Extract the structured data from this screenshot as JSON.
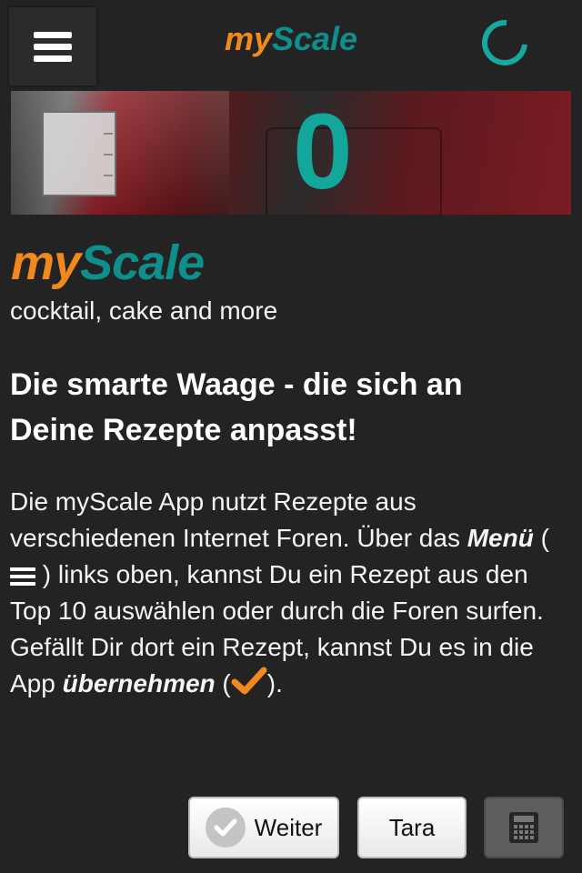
{
  "header": {
    "title_part1": "my",
    "title_part2": "Scale",
    "menu_icon": "hamburger-menu-icon",
    "status_icon": "loading-spinner-icon"
  },
  "scale": {
    "weight": "0"
  },
  "main": {
    "brand_part1": "my",
    "brand_part2": "Scale",
    "tagline": "cocktail, cake and more",
    "headline_line1": "Die smarte Waage - die sich an",
    "headline_line2": "Deine Rezepte anpasst!",
    "body_1": "Die myScale App nutzt Rezepte aus verschiedenen Internet Foren. Über das ",
    "body_menu_word": "Menü",
    "body_2": " ( ",
    "body_3": " ) links oben, kannst Du ein Rezept aus den Top 10 auswählen oder durch die Foren surfen. Gefällt Dir dort ein Rezept, kannst Du es in die App ",
    "body_take_word": "übernehmen",
    "body_4": " (",
    "body_5": ")."
  },
  "footer": {
    "weiter_label": "Weiter",
    "tara_label": "Tara",
    "calc_icon": "calculator-icon"
  },
  "colors": {
    "orange": "#f18a1c",
    "teal": "#0f8f8b",
    "weight": "#13a79c",
    "background": "#232323"
  }
}
